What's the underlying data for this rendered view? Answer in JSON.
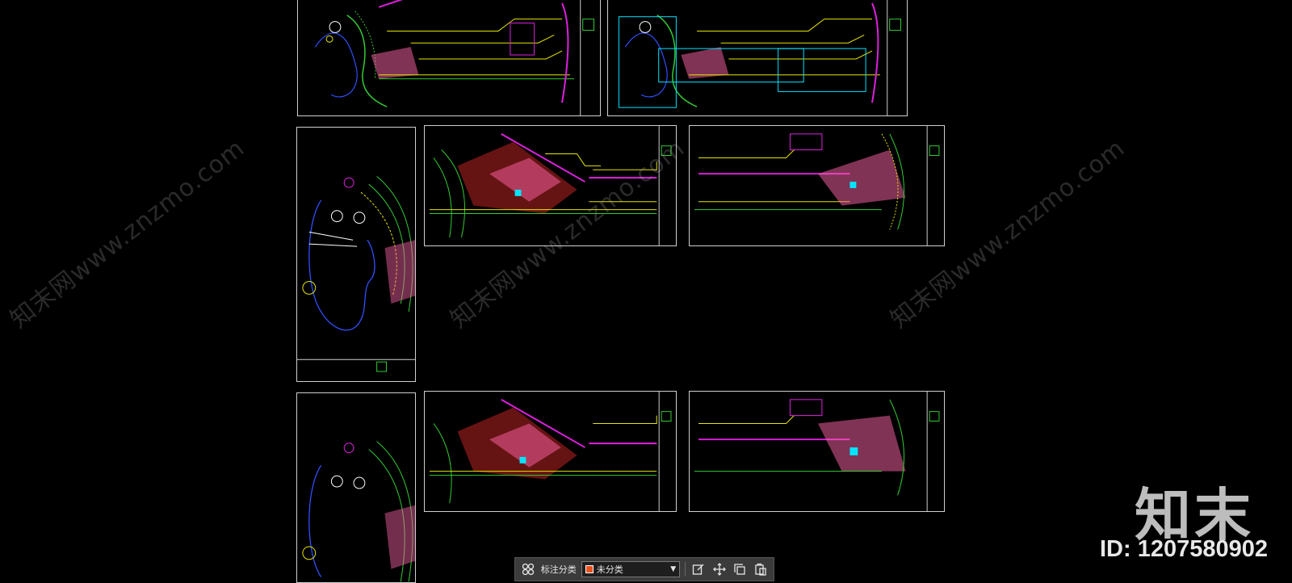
{
  "watermark": {
    "text": "知末网www.znzmo.com"
  },
  "brand": {
    "logo": "知末",
    "id_text": "ID: 1207580902"
  },
  "toolbar": {
    "grid_icon": "grid-icon",
    "label": "标注分类",
    "selected_category": "未分类",
    "category_color": "#e8531f",
    "icons": [
      "edit-icon",
      "move-icon",
      "copy-icon",
      "paste-icon"
    ]
  },
  "colors": {
    "background": "#000000",
    "frame": "#cfcfcf",
    "magenta": "#e020e0",
    "yellow": "#e6e600",
    "green": "#33cc33",
    "cyan": "#00e5ff",
    "red": "#ff3030",
    "pink": "#ff66aa",
    "blue": "#3050ff",
    "white": "#ffffff"
  }
}
